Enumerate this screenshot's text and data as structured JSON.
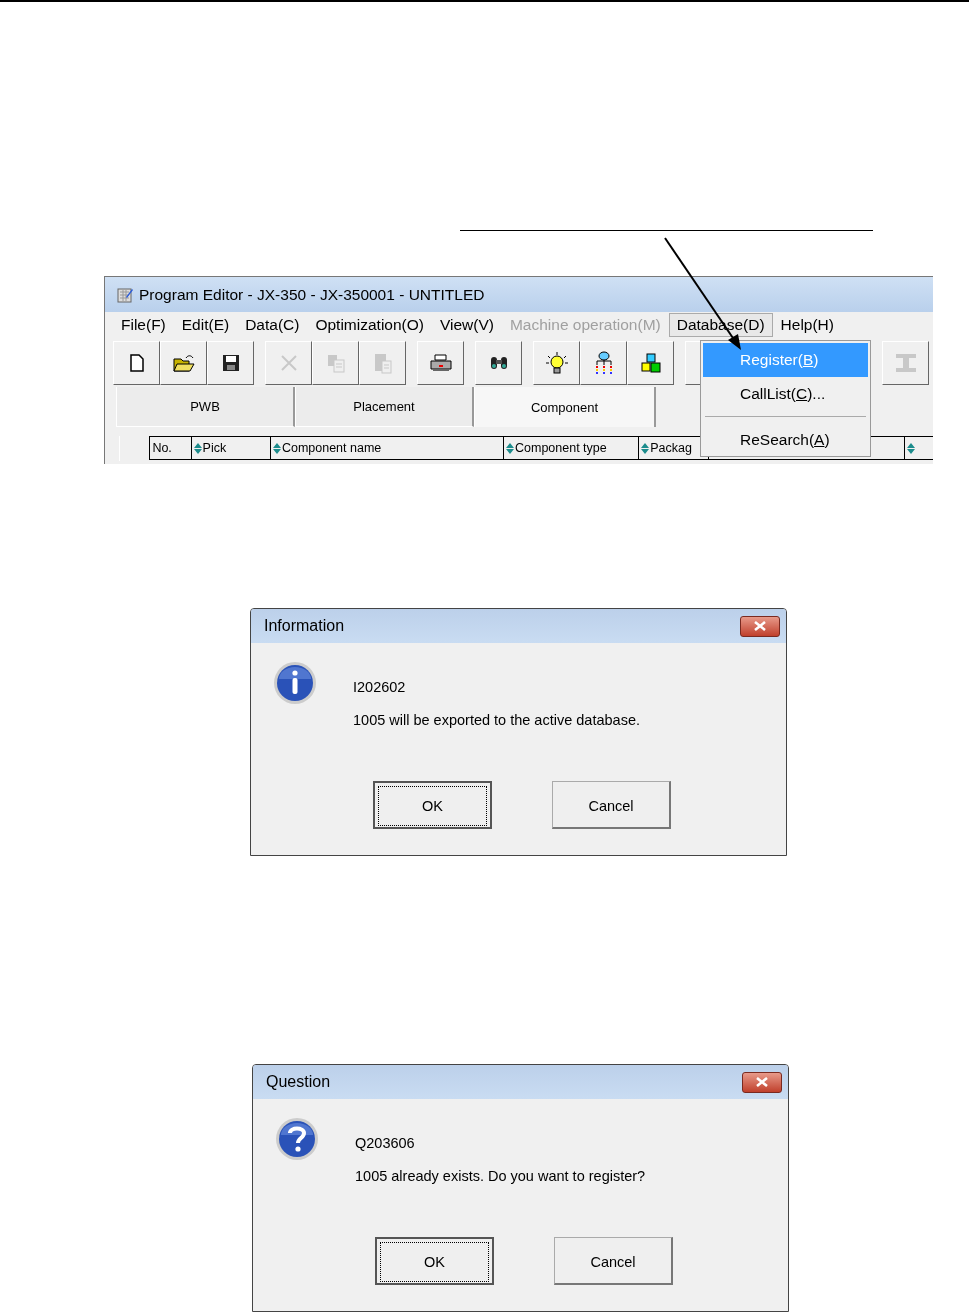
{
  "editor": {
    "title": "Program Editor - JX-350 - JX-350001 - UNTITLED",
    "menu": [
      {
        "label": "File(F)",
        "disabled": false,
        "open": false
      },
      {
        "label": "Edit(E)",
        "disabled": false,
        "open": false
      },
      {
        "label": "Data(C)",
        "disabled": false,
        "open": false
      },
      {
        "label": "Optimization(O)",
        "disabled": false,
        "open": false
      },
      {
        "label": "View(V)",
        "disabled": false,
        "open": false
      },
      {
        "label": "Machine operation(M)",
        "disabled": true,
        "open": false
      },
      {
        "label": "Database(D)",
        "disabled": false,
        "open": true
      },
      {
        "label": "Help(H)",
        "disabled": false,
        "open": false
      }
    ],
    "toolbar": {
      "groups": [
        [
          {
            "kind": "new",
            "disabled": false
          },
          {
            "kind": "open",
            "disabled": false
          },
          {
            "kind": "save",
            "disabled": false
          }
        ],
        [
          {
            "kind": "delete",
            "disabled": true
          },
          {
            "kind": "copy",
            "disabled": true
          },
          {
            "kind": "paste",
            "disabled": true
          }
        ],
        [
          {
            "kind": "print",
            "disabled": false
          }
        ],
        [
          {
            "kind": "find",
            "disabled": false
          }
        ],
        [
          {
            "kind": "bulb",
            "disabled": false
          },
          {
            "kind": "tree",
            "disabled": false
          },
          {
            "kind": "blocks",
            "disabled": false
          }
        ],
        [
          {
            "kind": "covered"
          }
        ]
      ],
      "right": [
        {
          "kind": "ibeam",
          "disabled": true
        }
      ]
    },
    "tabs": [
      {
        "label": "PWB",
        "selected": false
      },
      {
        "label": "Placement",
        "selected": false
      },
      {
        "label": "Component",
        "selected": true
      }
    ],
    "columns": [
      {
        "label": "No.",
        "kind": "plain"
      },
      {
        "label": "Pick",
        "kind": "sort"
      },
      {
        "label": "Component name",
        "kind": "sort"
      },
      {
        "label": "Component type",
        "kind": "sort"
      },
      {
        "label": "Packag",
        "kind": "sort"
      },
      {
        "kind": "sort"
      }
    ],
    "dropdown": [
      {
        "kind": "item",
        "before": "Register(",
        "key": "B",
        "after": ")",
        "selected": true
      },
      {
        "kind": "item",
        "before": "CallList(",
        "key": "C",
        "after": ")...",
        "selected": false
      },
      {
        "kind": "separator"
      },
      {
        "kind": "item",
        "before": "ReSearch(",
        "key": "A",
        "after": ")",
        "selected": false
      }
    ]
  },
  "dialogs": [
    {
      "title": "Information",
      "kind": "info",
      "code": "I202602",
      "message": "1005 will be exported to the active database.",
      "buttons": [
        {
          "label": "OK",
          "default": true
        },
        {
          "label": "Cancel",
          "default": false
        }
      ]
    },
    {
      "title": "Question",
      "kind": "question",
      "code": "Q203606",
      "message": "1005 already exists. Do you want to register?",
      "buttons": [
        {
          "label": "OK",
          "default": true
        },
        {
          "label": "Cancel",
          "default": false
        }
      ]
    }
  ]
}
